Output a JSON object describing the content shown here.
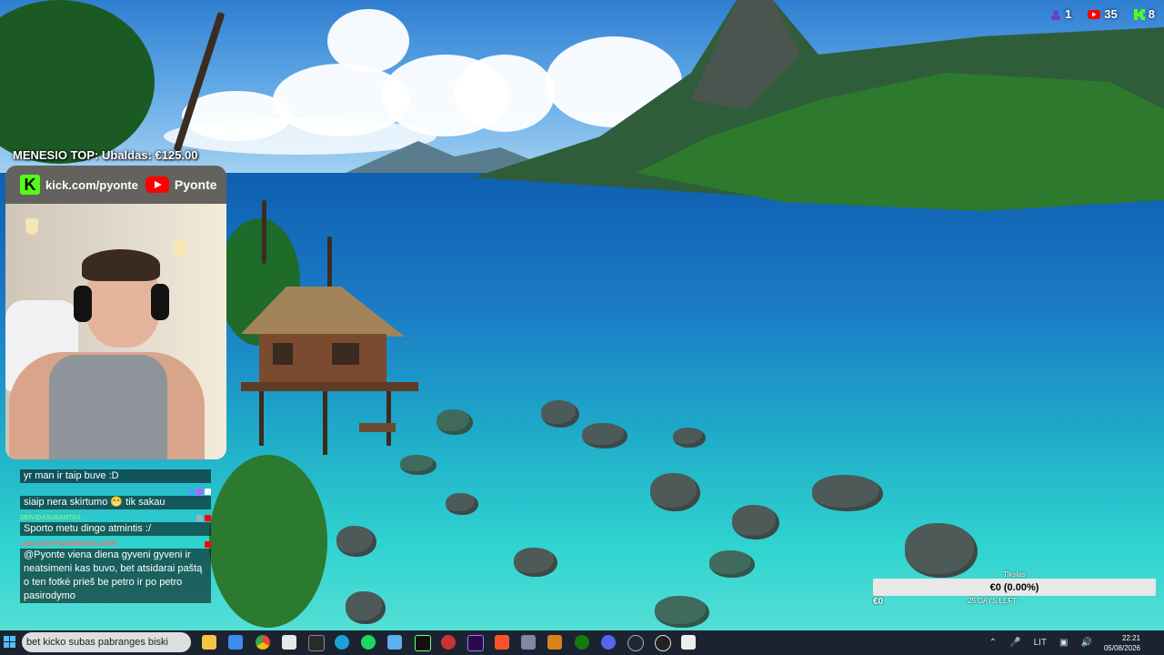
{
  "counters": {
    "kick_viewers": "1",
    "youtube_viewers": "35",
    "kick_followers": "8"
  },
  "top_donor": "MENESIO TOP: Ubaldas: €125.00",
  "camera": {
    "kick_url": "kick.com/pyonte",
    "youtube_name": "Pyonte",
    "kick_logo_letter": "K"
  },
  "chat": {
    "messages": [
      {
        "user": "",
        "text": "yr man ir taip buve :D"
      },
      {
        "user": "",
        "text": "siaip nera skirtumo 😁 tik sakau"
      },
      {
        "user": "DEIVIDASUBARTAS",
        "text": "Sporto metu dingo atmintis :/"
      },
      {
        "user": "LUKASSOFTWAREDEVELOPER",
        "text": "@Pyonte viena diena gyveni gyveni ir neatsimeni kas buvo, bet atsidarai paštą o ten fotkė prieš be petro ir po petro pasirodymo"
      }
    ]
  },
  "goal": {
    "title": "Tikslas",
    "value_text": "€0 (0.00%)",
    "progress_fraction": 0.0,
    "left_amount": "€0",
    "days_left": "25 DAYS LEFT"
  },
  "taskbar": {
    "search_text": "bet kicko subas pabranges biski",
    "language": "LIT",
    "time": "22:21",
    "date": "05/08/2026"
  },
  "colors": {
    "kick_green": "#53fc18",
    "youtube_red": "#ff0000",
    "taskbar_bg": "#1c2330"
  }
}
